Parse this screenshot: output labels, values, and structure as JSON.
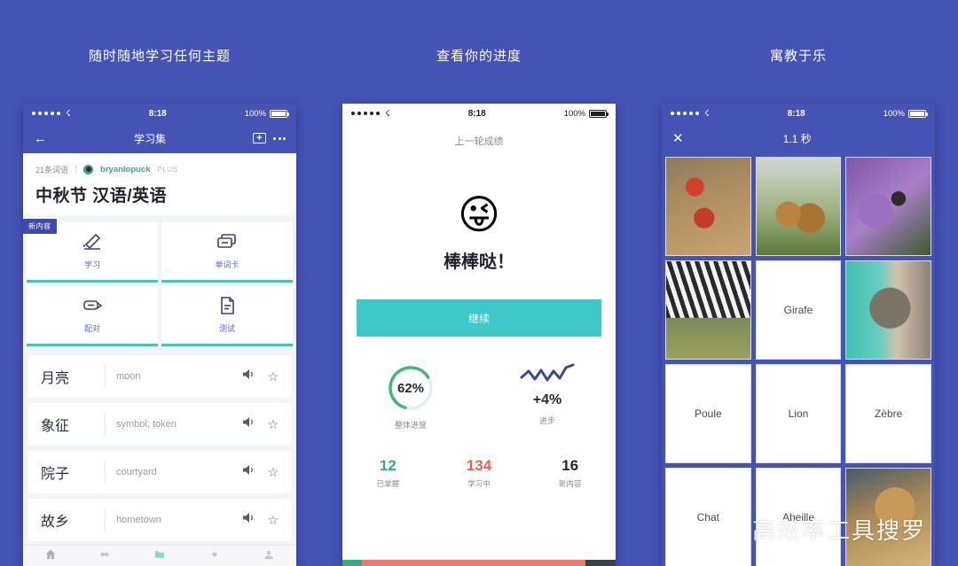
{
  "background_color": "#4553b5",
  "headlines": [
    {
      "text": "随时随地学习任何主题"
    },
    {
      "text": "查看你的进度"
    },
    {
      "text": "寓教于乐"
    }
  ],
  "phone1": {
    "status": {
      "time": "8:18",
      "battery": "100%",
      "signal_dots": 5,
      "wifi_icon": "wifi-icon"
    },
    "nav": {
      "back_icon": "back-arrow-icon",
      "title": "学习集",
      "add_folder_icon": "folder-add-icon",
      "more_icon": "more-dots-icon"
    },
    "set": {
      "term_count": "21条词语",
      "author": "bryanlopuck",
      "plus_tag": "PLUS",
      "title": "中秋节 汉语/英语",
      "new_badge": "新内容"
    },
    "modes": [
      {
        "label": "学习",
        "icon": "pencil-underline-icon"
      },
      {
        "label": "单词卡",
        "icon": "cards-stack-icon"
      },
      {
        "label": "配对",
        "icon": "match-cards-icon"
      },
      {
        "label": "测试",
        "icon": "document-test-icon"
      }
    ],
    "terms": [
      {
        "cn": "月亮",
        "en": "moon",
        "audio_icon": "speaker-icon",
        "star_icon": "star-outline-icon"
      },
      {
        "cn": "象征",
        "en": "symbol; token",
        "audio_icon": "speaker-icon",
        "star_icon": "star-outline-icon"
      },
      {
        "cn": "院子",
        "en": "courtyard",
        "audio_icon": "speaker-icon",
        "star_icon": "star-outline-icon"
      },
      {
        "cn": "故乡",
        "en": "hometown",
        "audio_icon": "speaker-icon",
        "star_icon": "star-outline-icon"
      }
    ],
    "tabs": [
      {
        "icon": "home-icon",
        "active": false
      },
      {
        "icon": "people-icon",
        "active": false
      },
      {
        "icon": "folder-icon",
        "active": true
      },
      {
        "icon": "circle-icon",
        "active": false
      },
      {
        "icon": "profile-icon",
        "active": false
      }
    ],
    "accent_underline": "#4dc0b5",
    "nav_color": "#4553b5"
  },
  "phone2": {
    "status": {
      "time": "8:18",
      "battery": "100%",
      "signal_dots": 5,
      "wifi_icon": "wifi-icon"
    },
    "subtitle": "上一轮成绩",
    "emoji": "😜",
    "headline": "棒棒哒！",
    "cta_label": "继续",
    "cta_color": "#3ec8c8",
    "progress_ring": {
      "value": "62%",
      "percent": 62,
      "caption": "整体进度",
      "color": "#3cb878",
      "track": "#e3f1e9"
    },
    "spark": {
      "value": "+4%",
      "caption": "进步",
      "color": "#3a4a8f"
    },
    "counters": [
      {
        "num": "12",
        "caption": "已掌握",
        "color": "#2fb07a"
      },
      {
        "num": "134",
        "caption": "学习中",
        "color": "#e8604f"
      },
      {
        "num": "16",
        "caption": "新内容",
        "color": "#22262f"
      }
    ],
    "segbar": [
      {
        "color": "#2fb07a",
        "width": "7%"
      },
      {
        "color": "#ef7a6d",
        "width": "82%"
      },
      {
        "color": "#3c4048",
        "width": "11%"
      }
    ]
  },
  "phone3": {
    "status": {
      "time": "8:18",
      "battery": "100%",
      "signal_dots": 5,
      "wifi_icon": "wifi-icon"
    },
    "nav": {
      "close_icon": "close-x-icon",
      "title": "1.1 秒"
    },
    "cells": [
      {
        "type": "image",
        "photo": "ph-chicken",
        "name": "chicken-photo"
      },
      {
        "type": "image",
        "photo": "ph-giraffe",
        "name": "giraffe-photo"
      },
      {
        "type": "image",
        "photo": "ph-bee",
        "name": "bee-photo"
      },
      {
        "type": "image",
        "photo": "ph-zebra",
        "name": "zebra-photo"
      },
      {
        "type": "text",
        "label": "Girafe"
      },
      {
        "type": "image",
        "photo": "ph-cat",
        "name": "cat-photo"
      },
      {
        "type": "text",
        "label": "Poule"
      },
      {
        "type": "text",
        "label": "Lion"
      },
      {
        "type": "text",
        "label": "Zèbre"
      },
      {
        "type": "text",
        "label": "Chat"
      },
      {
        "type": "text",
        "label": "Abeille"
      },
      {
        "type": "image",
        "photo": "ph-lion",
        "name": "lion-photo"
      }
    ]
  },
  "watermark": {
    "text": "高效率工具搜罗",
    "logo_icon": "wechat-icon"
  }
}
